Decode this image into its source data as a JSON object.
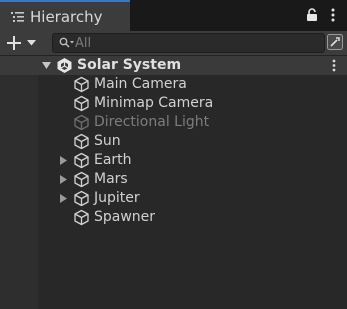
{
  "tab": {
    "title": "Hierarchy",
    "icon": "hierarchy-list-icon"
  },
  "toolbar": {
    "search_placeholder": "All",
    "add_icon": "plus-icon",
    "dropdown_icon": "chevron-down-icon"
  },
  "scene": {
    "name": "Solar System",
    "expanded": true
  },
  "objects": [
    {
      "name": "Main Camera",
      "has_children": false,
      "active": true
    },
    {
      "name": "Minimap Camera",
      "has_children": false,
      "active": true
    },
    {
      "name": "Directional Light",
      "has_children": false,
      "active": false
    },
    {
      "name": "Sun",
      "has_children": false,
      "active": true
    },
    {
      "name": "Earth",
      "has_children": true,
      "active": true
    },
    {
      "name": "Mars",
      "has_children": true,
      "active": true
    },
    {
      "name": "Jupiter",
      "has_children": true,
      "active": true
    },
    {
      "name": "Spawner",
      "has_children": false,
      "active": true
    }
  ],
  "colors": {
    "accent": "#3a79bb",
    "panel": "#282828",
    "tabbar": "#191919",
    "dim_text": "#7d7d7d"
  }
}
